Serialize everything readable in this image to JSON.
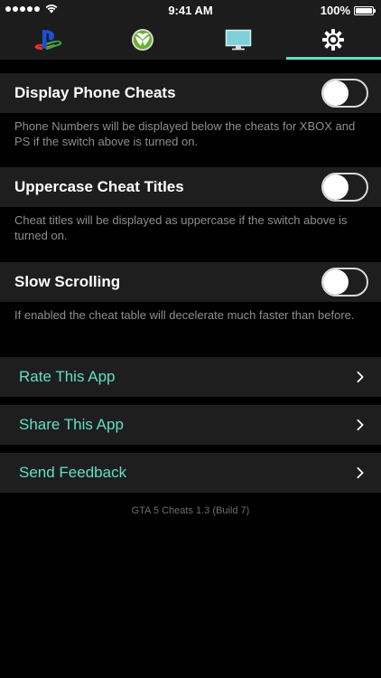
{
  "status_bar": {
    "time": "9:41 AM",
    "battery_text": "100%",
    "signal_icon": "signal-dots-icon",
    "wifi_icon": "wifi-icon",
    "battery_icon": "battery-icon"
  },
  "tabs": [
    {
      "icon": "playstation-icon",
      "active": false
    },
    {
      "icon": "xbox-icon",
      "active": false
    },
    {
      "icon": "monitor-icon",
      "active": false
    },
    {
      "icon": "gear-icon",
      "active": true
    }
  ],
  "accent_color": "#61dfc4",
  "settings": {
    "display_phone": {
      "label": "Display Phone Cheats",
      "note": "Phone Numbers will be displayed below the cheats for XBOX and PS if the switch above is turned on.",
      "enabled": false
    },
    "uppercase_titles": {
      "label": "Uppercase Cheat Titles",
      "note": "Cheat titles will be displayed as uppercase if the switch above is turned on.",
      "enabled": false
    },
    "slow_scrolling": {
      "label": "Slow Scrolling",
      "note": "If enabled the cheat table will decelerate much faster than before.",
      "enabled": false
    }
  },
  "links": {
    "rate": "Rate This App",
    "share": "Share This App",
    "feedback": "Send Feedback"
  },
  "version": "GTA 5 Cheats 1.3 (Build 7)"
}
